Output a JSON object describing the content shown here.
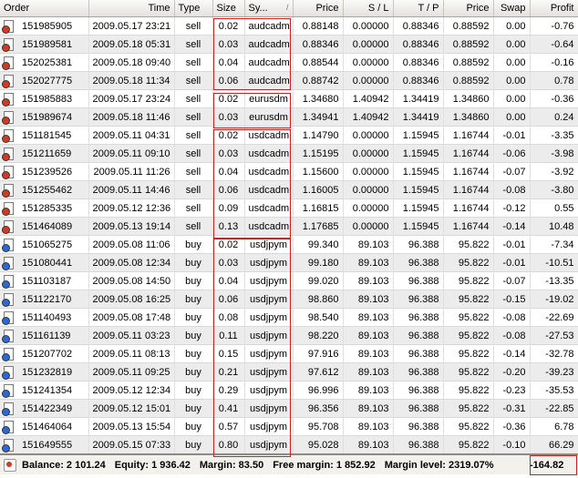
{
  "columns": {
    "order": "Order",
    "time": "Time",
    "type": "Type",
    "size": "Size",
    "symbol": "Sy...",
    "symbol_sort": "/",
    "price": "Price",
    "sl": "S / L",
    "tp": "T / P",
    "price2": "Price",
    "swap": "Swap",
    "profit": "Profit"
  },
  "orders": [
    {
      "order": "151985905",
      "time": "2009.05.17 23:21",
      "type": "sell",
      "size": "0.02",
      "symbol": "audcadm",
      "price": "0.88148",
      "sl": "0.00000",
      "tp": "0.88346",
      "price2": "0.88592",
      "swap": "0.00",
      "profit": "-0.76"
    },
    {
      "order": "151989581",
      "time": "2009.05.18 05:31",
      "type": "sell",
      "size": "0.03",
      "symbol": "audcadm",
      "price": "0.88346",
      "sl": "0.00000",
      "tp": "0.88346",
      "price2": "0.88592",
      "swap": "0.00",
      "profit": "-0.64"
    },
    {
      "order": "152025381",
      "time": "2009.05.18 09:40",
      "type": "sell",
      "size": "0.04",
      "symbol": "audcadm",
      "price": "0.88544",
      "sl": "0.00000",
      "tp": "0.88346",
      "price2": "0.88592",
      "swap": "0.00",
      "profit": "-0.16"
    },
    {
      "order": "152027775",
      "time": "2009.05.18 11:34",
      "type": "sell",
      "size": "0.06",
      "symbol": "audcadm",
      "price": "0.88742",
      "sl": "0.00000",
      "tp": "0.88346",
      "price2": "0.88592",
      "swap": "0.00",
      "profit": "0.78"
    },
    {
      "order": "151985883",
      "time": "2009.05.17 23:24",
      "type": "sell",
      "size": "0.02",
      "symbol": "eurusdm",
      "price": "1.34680",
      "sl": "1.40942",
      "tp": "1.34419",
      "price2": "1.34860",
      "swap": "0.00",
      "profit": "-0.36"
    },
    {
      "order": "151989674",
      "time": "2009.05.18 11:46",
      "type": "sell",
      "size": "0.03",
      "symbol": "eurusdm",
      "price": "1.34941",
      "sl": "1.40942",
      "tp": "1.34419",
      "price2": "1.34860",
      "swap": "0.00",
      "profit": "0.24"
    },
    {
      "order": "151181545",
      "time": "2009.05.11 04:31",
      "type": "sell",
      "size": "0.02",
      "symbol": "usdcadm",
      "price": "1.14790",
      "sl": "0.00000",
      "tp": "1.15945",
      "price2": "1.16744",
      "swap": "-0.01",
      "profit": "-3.35"
    },
    {
      "order": "151211659",
      "time": "2009.05.11 09:10",
      "type": "sell",
      "size": "0.03",
      "symbol": "usdcadm",
      "price": "1.15195",
      "sl": "0.00000",
      "tp": "1.15945",
      "price2": "1.16744",
      "swap": "-0.06",
      "profit": "-3.98"
    },
    {
      "order": "151239526",
      "time": "2009.05.11 11:26",
      "type": "sell",
      "size": "0.04",
      "symbol": "usdcadm",
      "price": "1.15600",
      "sl": "0.00000",
      "tp": "1.15945",
      "price2": "1.16744",
      "swap": "-0.07",
      "profit": "-3.92"
    },
    {
      "order": "151255462",
      "time": "2009.05.11 14:46",
      "type": "sell",
      "size": "0.06",
      "symbol": "usdcadm",
      "price": "1.16005",
      "sl": "0.00000",
      "tp": "1.15945",
      "price2": "1.16744",
      "swap": "-0.08",
      "profit": "-3.80"
    },
    {
      "order": "151285335",
      "time": "2009.05.12 12:36",
      "type": "sell",
      "size": "0.09",
      "symbol": "usdcadm",
      "price": "1.16815",
      "sl": "0.00000",
      "tp": "1.15945",
      "price2": "1.16744",
      "swap": "-0.12",
      "profit": "0.55"
    },
    {
      "order": "151464089",
      "time": "2009.05.13 19:14",
      "type": "sell",
      "size": "0.13",
      "symbol": "usdcadm",
      "price": "1.17685",
      "sl": "0.00000",
      "tp": "1.15945",
      "price2": "1.16744",
      "swap": "-0.14",
      "profit": "10.48"
    },
    {
      "order": "151065275",
      "time": "2009.05.08 11:06",
      "type": "buy",
      "size": "0.02",
      "symbol": "usdjpym",
      "price": "99.340",
      "sl": "89.103",
      "tp": "96.388",
      "price2": "95.822",
      "swap": "-0.01",
      "profit": "-7.34"
    },
    {
      "order": "151080441",
      "time": "2009.05.08 12:34",
      "type": "buy",
      "size": "0.03",
      "symbol": "usdjpym",
      "price": "99.180",
      "sl": "89.103",
      "tp": "96.388",
      "price2": "95.822",
      "swap": "-0.01",
      "profit": "-10.51"
    },
    {
      "order": "151103187",
      "time": "2009.05.08 14:50",
      "type": "buy",
      "size": "0.04",
      "symbol": "usdjpym",
      "price": "99.020",
      "sl": "89.103",
      "tp": "96.388",
      "price2": "95.822",
      "swap": "-0.07",
      "profit": "-13.35"
    },
    {
      "order": "151122170",
      "time": "2009.05.08 16:25",
      "type": "buy",
      "size": "0.06",
      "symbol": "usdjpym",
      "price": "98.860",
      "sl": "89.103",
      "tp": "96.388",
      "price2": "95.822",
      "swap": "-0.15",
      "profit": "-19.02"
    },
    {
      "order": "151140493",
      "time": "2009.05.08 17:48",
      "type": "buy",
      "size": "0.08",
      "symbol": "usdjpym",
      "price": "98.540",
      "sl": "89.103",
      "tp": "96.388",
      "price2": "95.822",
      "swap": "-0.08",
      "profit": "-22.69"
    },
    {
      "order": "151161139",
      "time": "2009.05.11 03:23",
      "type": "buy",
      "size": "0.11",
      "symbol": "usdjpym",
      "price": "98.220",
      "sl": "89.103",
      "tp": "96.388",
      "price2": "95.822",
      "swap": "-0.08",
      "profit": "-27.53"
    },
    {
      "order": "151207702",
      "time": "2009.05.11 08:13",
      "type": "buy",
      "size": "0.15",
      "symbol": "usdjpym",
      "price": "97.916",
      "sl": "89.103",
      "tp": "96.388",
      "price2": "95.822",
      "swap": "-0.14",
      "profit": "-32.78"
    },
    {
      "order": "151232819",
      "time": "2009.05.11 09:25",
      "type": "buy",
      "size": "0.21",
      "symbol": "usdjpym",
      "price": "97.612",
      "sl": "89.103",
      "tp": "96.388",
      "price2": "95.822",
      "swap": "-0.20",
      "profit": "-39.23"
    },
    {
      "order": "151241354",
      "time": "2009.05.12 12:34",
      "type": "buy",
      "size": "0.29",
      "symbol": "usdjpym",
      "price": "96.996",
      "sl": "89.103",
      "tp": "96.388",
      "price2": "95.822",
      "swap": "-0.23",
      "profit": "-35.53"
    },
    {
      "order": "151422349",
      "time": "2009.05.12 15:01",
      "type": "buy",
      "size": "0.41",
      "symbol": "usdjpym",
      "price": "96.356",
      "sl": "89.103",
      "tp": "96.388",
      "price2": "95.822",
      "swap": "-0.31",
      "profit": "-22.85"
    },
    {
      "order": "151464064",
      "time": "2009.05.13 15:54",
      "type": "buy",
      "size": "0.57",
      "symbol": "usdjpym",
      "price": "95.708",
      "sl": "89.103",
      "tp": "96.388",
      "price2": "95.822",
      "swap": "-0.36",
      "profit": "6.78"
    },
    {
      "order": "151649555",
      "time": "2009.05.15 07:33",
      "type": "buy",
      "size": "0.80",
      "symbol": "usdjpym",
      "price": "95.028",
      "sl": "89.103",
      "tp": "96.388",
      "price2": "95.822",
      "swap": "-0.10",
      "profit": "66.29"
    }
  ],
  "summary": {
    "balance": "Balance: 2 101.24",
    "equity": "Equity: 1 936.42",
    "margin": "Margin: 83.50",
    "free_margin": "Free margin: 1 852.92",
    "margin_level": "Margin level: 2319.07%",
    "total_profit": "-164.82"
  },
  "colors": {
    "sell_icon": "#d43b1e",
    "buy_icon": "#2a6ad8",
    "highlight_box": "#d02020",
    "alt_row": "#ececec"
  }
}
